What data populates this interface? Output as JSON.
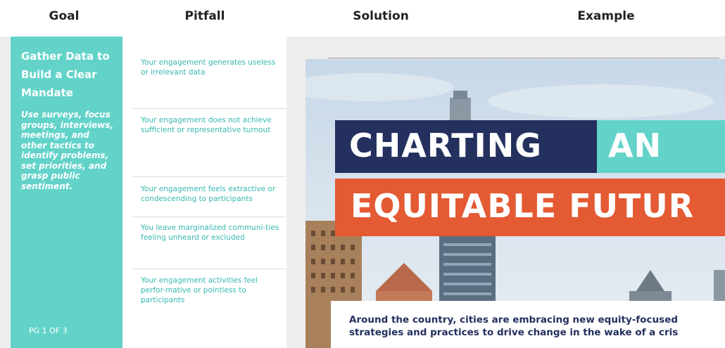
{
  "headers": {
    "goal": "Goal",
    "pitfall": "Pitfall",
    "solution": "Solution",
    "example": "Example"
  },
  "goal": {
    "title": "Gather Data to Build a Clear Mandate",
    "description": "Use surveys, focus groups, interviews, meetings, and other tactics to identify problems, set priorities, and grasp public sentiment."
  },
  "pitfalls": [
    "Your engagement generates useless or irrelevant data",
    "Your engagement does not achieve sufficient or representative turnout",
    "Your engagement feels extractive or condescending to participants",
    "You leave marginalized communi-ties feeling unheard or excluded",
    "Your engagement activities feel perfor-mative or pointless to participants"
  ],
  "example": {
    "title_line1": "CHARTING",
    "title_line1_accent": "AN",
    "title_line2": "EQUITABLE FUTUR",
    "caption_line1": "Around the country, cities are embracing new equity-focused",
    "caption_line2": "strategies and practices to drive change in the wake of a cris"
  },
  "page_indicator": "PG 1 OF 3",
  "colors": {
    "teal": "#63d3c9",
    "navy": "#24305e",
    "orange": "#e35a33",
    "pitfall_text": "#38b8b0"
  }
}
